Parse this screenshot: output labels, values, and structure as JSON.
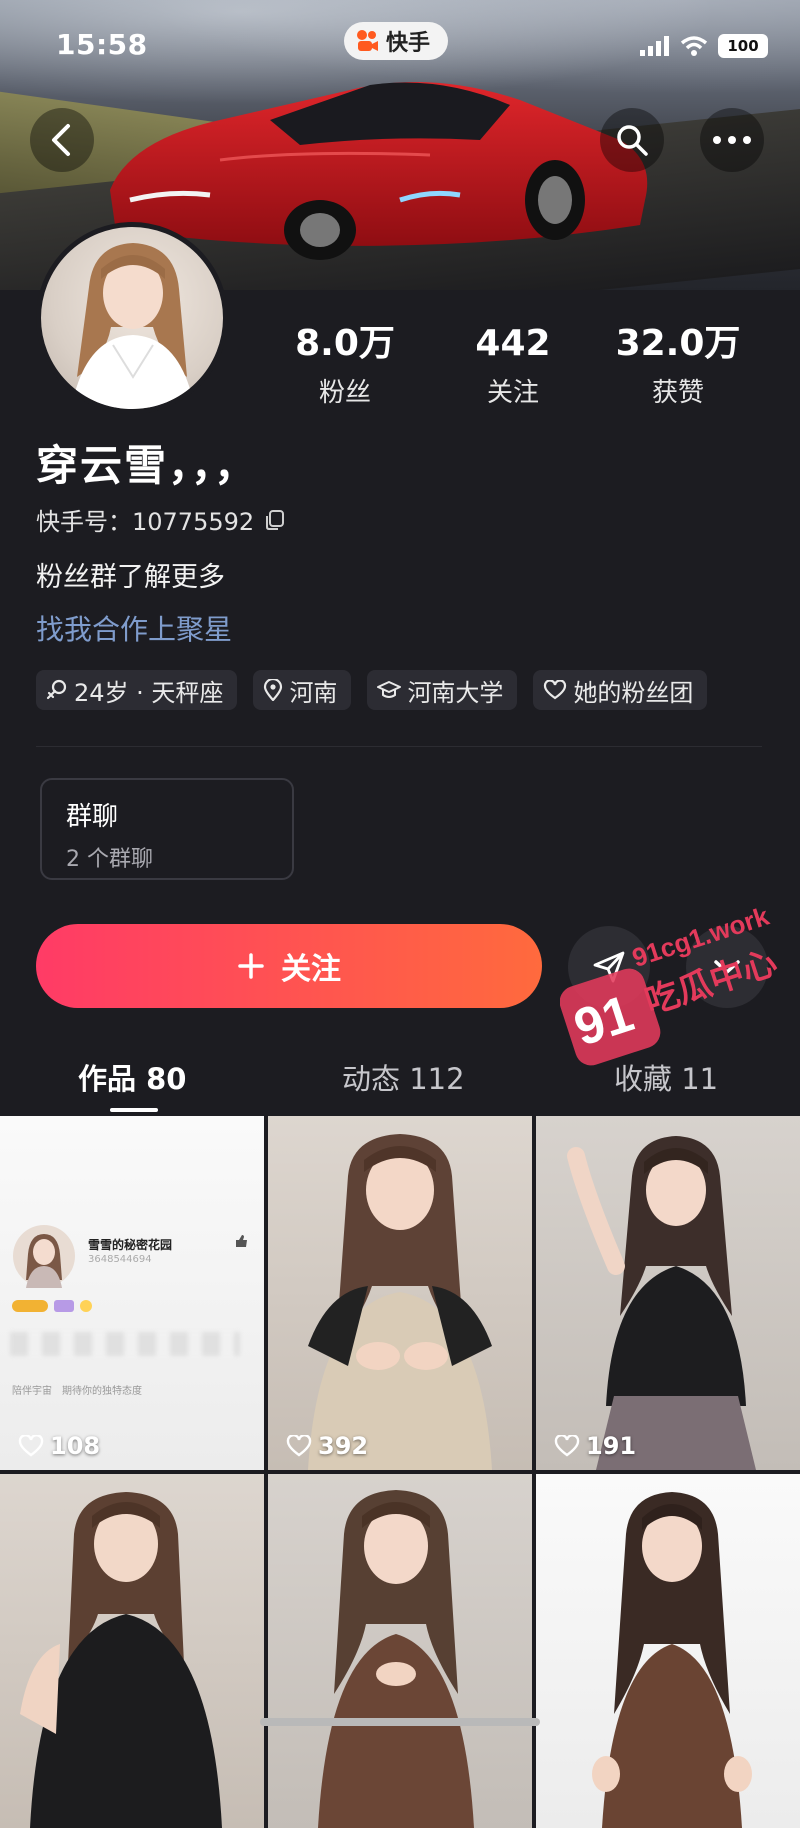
{
  "status_bar": {
    "time": "15:58",
    "app_name": "快手",
    "battery": "100"
  },
  "profile": {
    "stats": [
      {
        "value": "8.0万",
        "label": "粉丝"
      },
      {
        "value": "442",
        "label": "关注"
      },
      {
        "value": "32.0万",
        "label": "获赞"
      }
    ],
    "name": "穿云雪，，，",
    "kuaishou_id": "快手号：10775592",
    "bio": "粉丝群了解更多",
    "link_text": "找我合作上聚星",
    "tags": [
      {
        "icon": "gender-female-icon",
        "text": "24岁 · 天秤座"
      },
      {
        "icon": "location-pin-icon",
        "text": "河南"
      },
      {
        "icon": "graduation-cap-icon",
        "text": "河南大学"
      },
      {
        "icon": "heart-outline-icon",
        "text": "她的粉丝团"
      }
    ]
  },
  "group_chat": {
    "title": "群聊",
    "subtitle": "2 个群聊"
  },
  "actions": {
    "follow_label": "关注"
  },
  "watermark": {
    "domain": "91cg1.work",
    "brand": "吃瓜中心",
    "number": "91"
  },
  "tabs": [
    {
      "label": "作品 80",
      "active": true
    },
    {
      "label": "动态 112",
      "active": false
    },
    {
      "label": "收藏 11",
      "active": false
    }
  ],
  "grid_tiles": [
    {
      "likes": "108",
      "kind": "screenshot"
    },
    {
      "likes": "392",
      "kind": "photo"
    },
    {
      "likes": "191",
      "kind": "photo"
    },
    {
      "likes": "",
      "kind": "photo"
    },
    {
      "likes": "",
      "kind": "photo"
    },
    {
      "likes": "",
      "kind": "photo"
    }
  ],
  "mini_card": {
    "name": "雪雪的秘密花园",
    "id": "3648544694",
    "line_a": "陪伴宇宙",
    "line_b": "期待你的独特态度"
  },
  "colors": {
    "background": "#1c1c21",
    "follow_gradient_start": "#ff3b66",
    "follow_gradient_end": "#ff6a3d",
    "link": "#7f9ccc"
  }
}
